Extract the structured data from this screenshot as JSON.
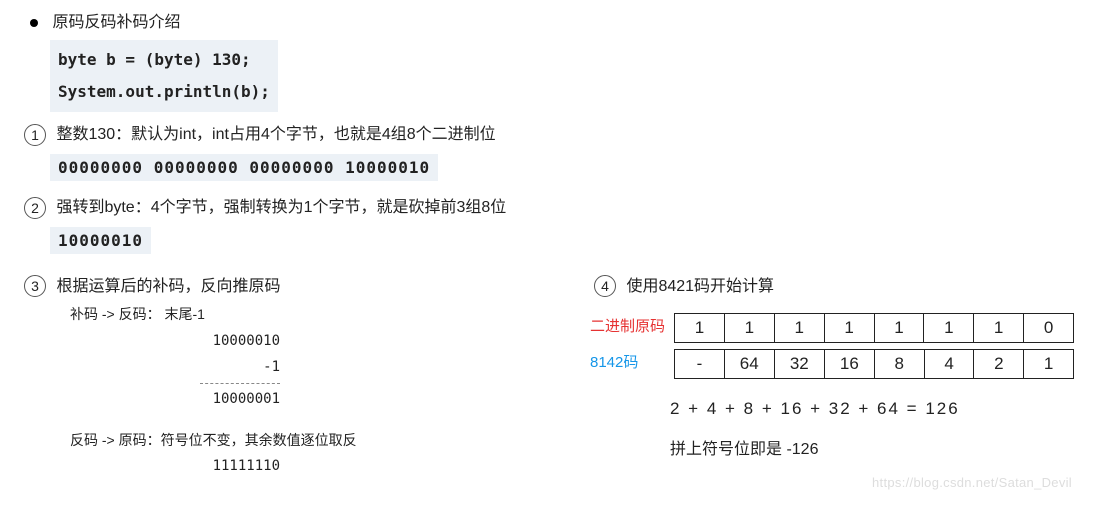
{
  "header": {
    "title": "原码反码补码介绍"
  },
  "code": {
    "line1": "byte b = (byte) 130;",
    "line2": "System.out.println(b);"
  },
  "steps": {
    "s1_num": "1",
    "s1_text": "整数130：默认为int，int占用4个字节，也就是4组8个二进制位",
    "s1_bin": "00000000 00000000 00000000 10000010",
    "s2_num": "2",
    "s2_text": "强转到byte：4个字节，强制转换为1个字节，就是砍掉前3组8位",
    "s2_bin": "10000010",
    "s3_num": "3",
    "s3_text": "根据运算后的补码，反向推原码",
    "s4_num": "4",
    "s4_text": "使用8421码开始计算"
  },
  "derivation": {
    "label1": "补码 -> 反码： 末尾-1",
    "v1": "10000010",
    "v2": "-1",
    "v3": "10000001",
    "label2": "反码 -> 原码：符号位不变，其余数值逐位取反",
    "v4": "11111110"
  },
  "table": {
    "label_red": "二进制原码",
    "label_blue": "8142码",
    "red": [
      "1",
      "1",
      "1",
      "1",
      "1",
      "1",
      "1",
      "0"
    ],
    "blue": [
      "-",
      "64",
      "32",
      "16",
      "8",
      "4",
      "2",
      "1"
    ]
  },
  "result": {
    "sum": "2 + 4 + 8 + 16 + 32 + 64 = 126",
    "final": "拼上符号位即是 -126"
  },
  "watermark": "https://blog.csdn.net/Satan_Devil"
}
